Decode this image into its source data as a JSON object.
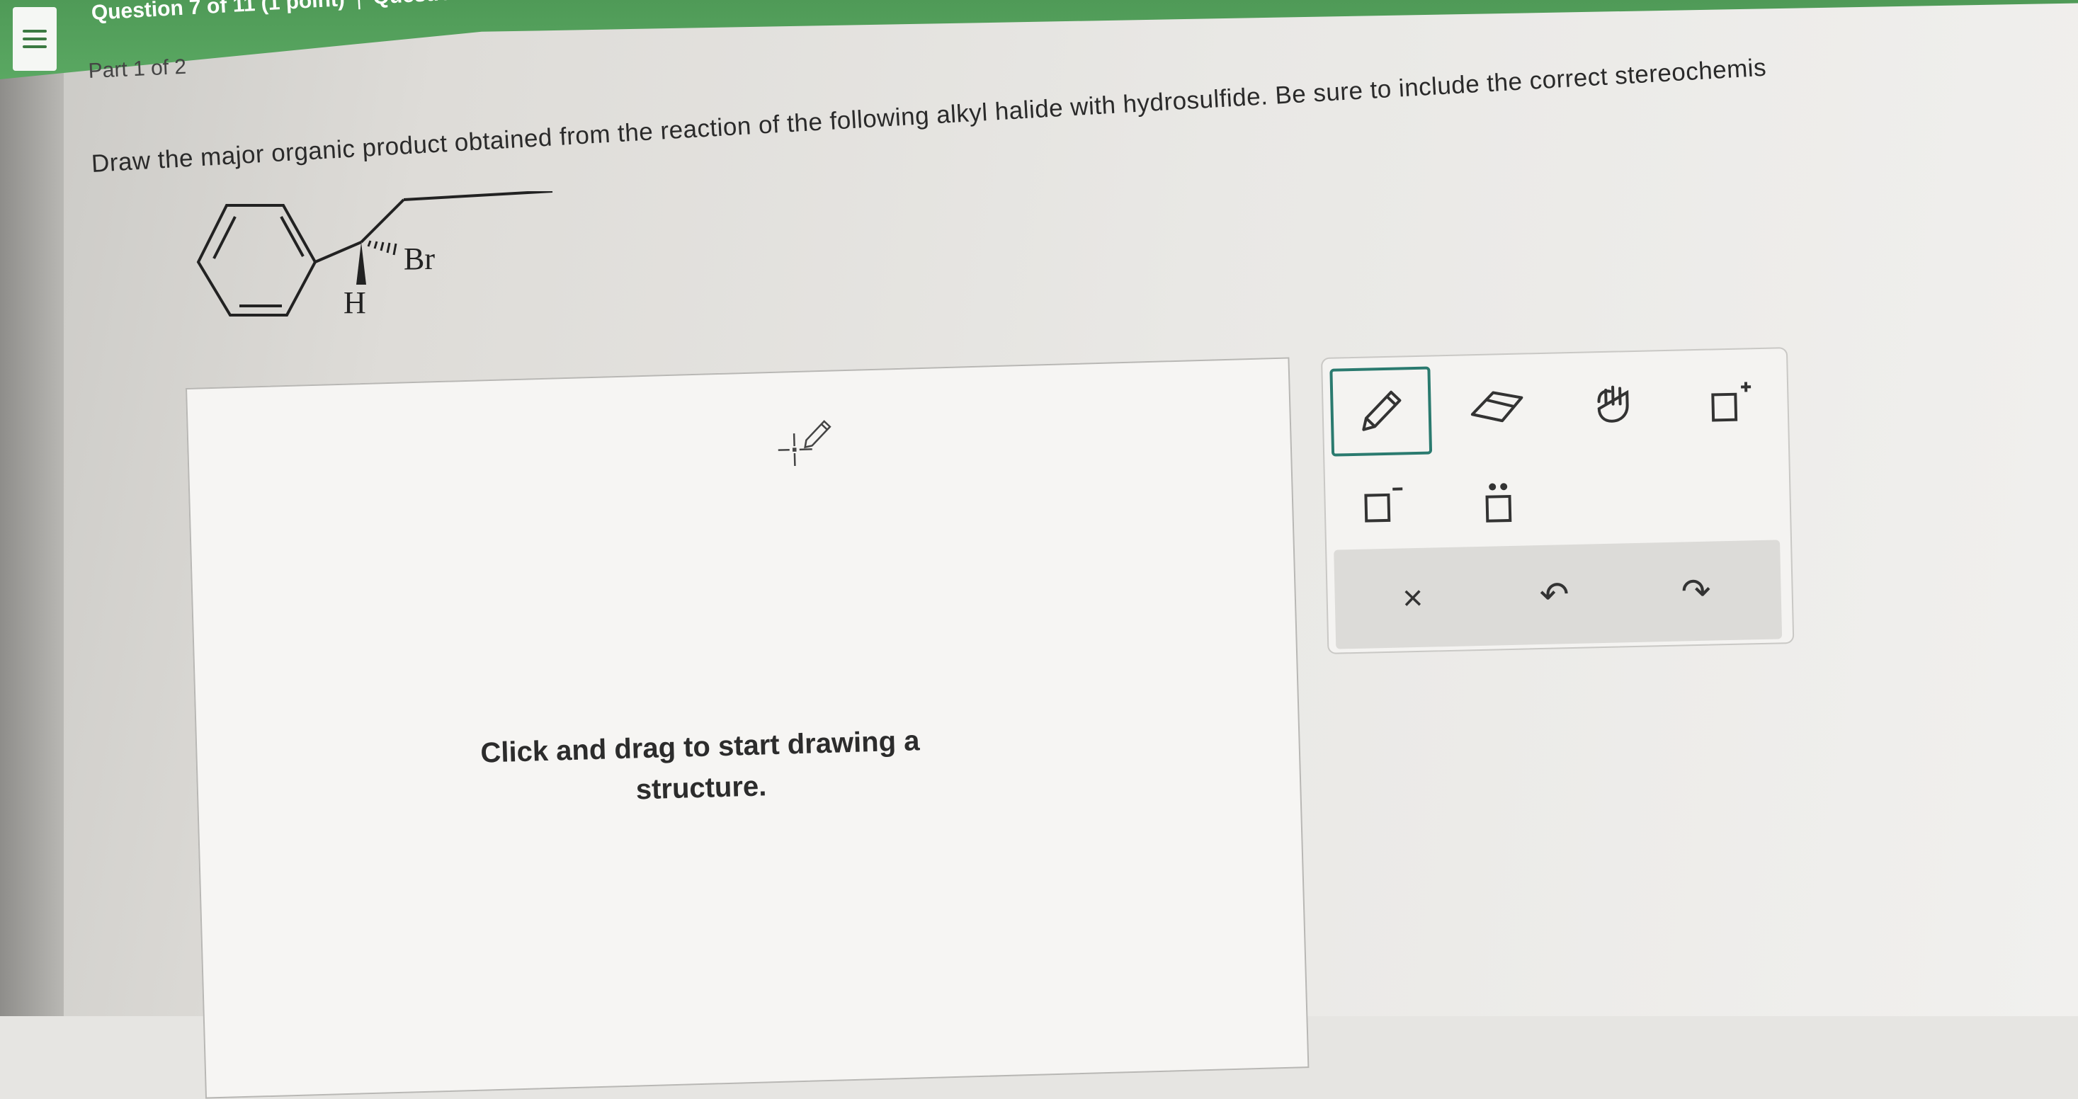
{
  "header": {
    "title": "Question 7 of 11 (1 point)",
    "separator": "|",
    "attempt_text": "Question Attempt"
  },
  "part_label": "Part 1 of 2",
  "question_text": "Draw the major organic product obtained from the reaction of the following alkyl halide with hydrosulfide. Be sure to include the correct stereochemis",
  "molecule": {
    "atoms": [
      "Br",
      "H"
    ]
  },
  "canvas": {
    "hint_line1": "Click and drag to start drawing a",
    "hint_line2": "structure."
  },
  "toolbar": {
    "tools": [
      {
        "name": "pencil-icon",
        "selected": true
      },
      {
        "name": "eraser-icon",
        "selected": false
      },
      {
        "name": "hand-icon",
        "selected": false
      },
      {
        "name": "positive-charge-icon",
        "selected": false
      },
      {
        "name": "negative-charge-icon",
        "selected": false
      },
      {
        "name": "lone-pair-icon",
        "selected": false
      }
    ],
    "actions": [
      "×",
      "↶",
      "↷"
    ]
  },
  "colors": {
    "header_green": "#5aa862",
    "selected_tool_border": "#2a7a6f"
  }
}
